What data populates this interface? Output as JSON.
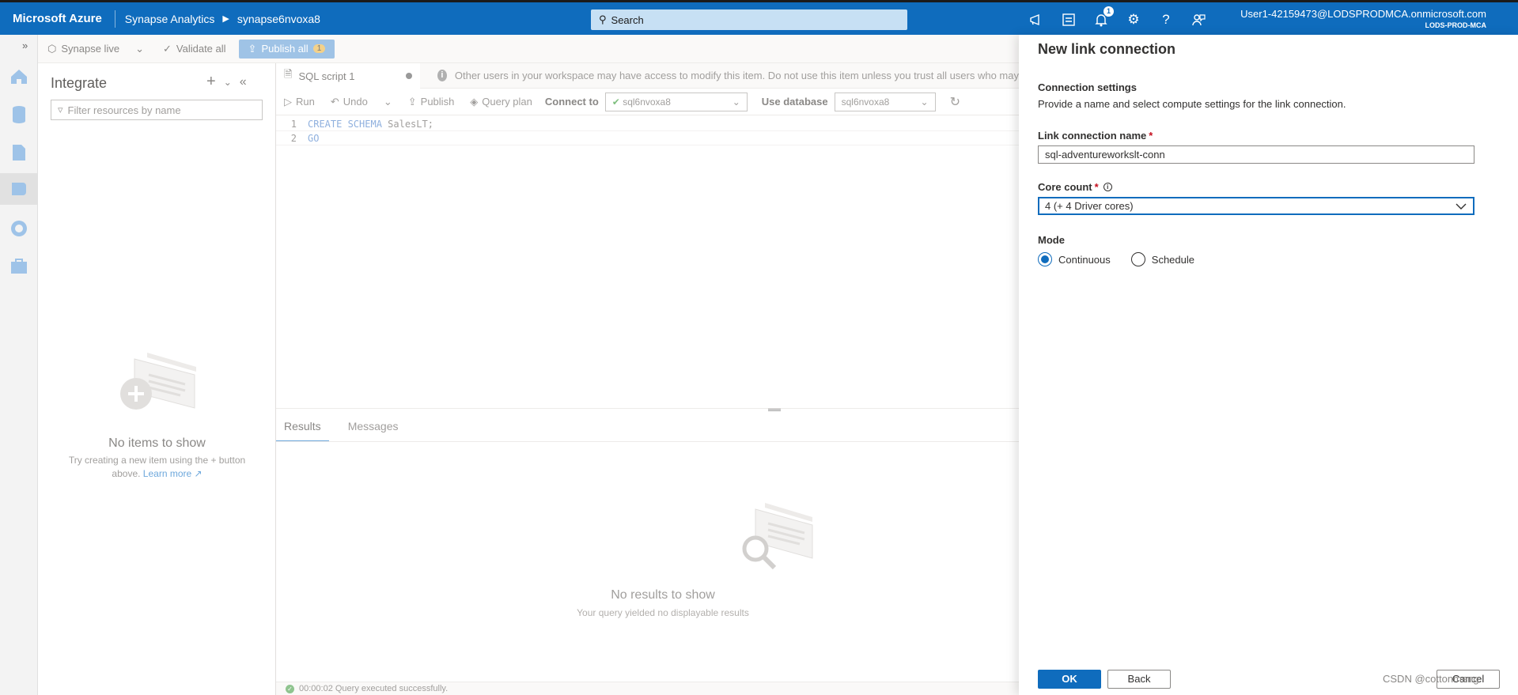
{
  "topbar": {
    "brand": "Microsoft Azure",
    "service": "Synapse Analytics",
    "workspace": "synapse6nvoxa8",
    "search_placeholder": "Search",
    "notifications_count": "1",
    "user_email": "User1-42159473@LODSPRODMCA.onmicrosoft.com",
    "tenant": "LODS-PROD-MCA"
  },
  "toolbar": {
    "synapse_live": "Synapse live",
    "validate_all": "Validate all",
    "publish_all": "Publish all",
    "publish_count": "1"
  },
  "integrate": {
    "title": "Integrate",
    "filter_placeholder": "Filter resources by name",
    "empty_title": "No items to show",
    "empty_text": "Try creating a new item using the + button above.",
    "learn_more": "Learn more"
  },
  "editor": {
    "tab_name": "SQL script 1",
    "warning": "Other users in your workspace may have access to modify this item. Do not use this item unless you trust all users who may",
    "run": "Run",
    "undo": "Undo",
    "publish": "Publish",
    "query_plan": "Query plan",
    "connect_to_label": "Connect to",
    "connect_to_value": "sql6nvoxa8",
    "use_database_label": "Use database",
    "use_database_value": "sql6nvoxa8",
    "lines": [
      {
        "num": "1",
        "keyword": "CREATE SCHEMA",
        "rest": "SalesLT;"
      },
      {
        "num": "2",
        "keyword": "GO",
        "rest": ""
      }
    ],
    "results_tab": "Results",
    "messages_tab": "Messages",
    "no_results": "No results to show",
    "no_results_sub": "Your query yielded no displayable results",
    "status": "00:00:02 Query executed successfully."
  },
  "panel": {
    "title": "New link connection",
    "section_title": "Connection settings",
    "section_desc": "Provide a name and select compute settings for the link connection.",
    "name_label": "Link connection name",
    "name_value": "sql-adventureworkslt-conn",
    "core_label": "Core count",
    "core_value": "4 (+ 4 Driver cores)",
    "mode_label": "Mode",
    "mode_continuous": "Continuous",
    "mode_schedule": "Schedule",
    "ok": "OK",
    "back": "Back",
    "cancel": "Cancel"
  },
  "watermark": "CSDN @cotton­meng",
  "colors": {
    "azure_blue": "#0f6cbd",
    "required": "#c50f1f"
  }
}
